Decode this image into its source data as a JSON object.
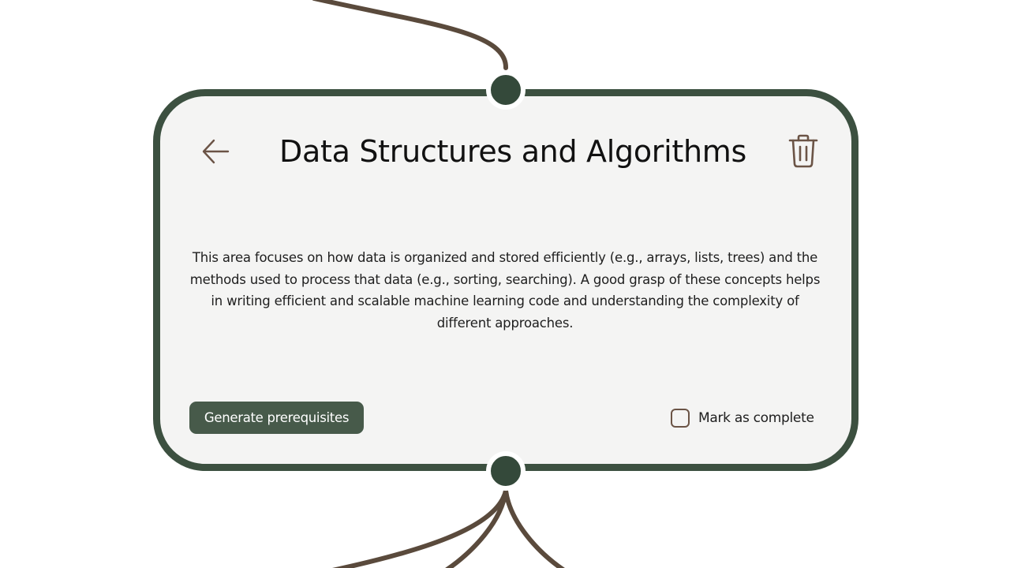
{
  "node": {
    "title": "Data Structures and Algorithms",
    "description": "This area focuses on how data is organized and stored efficiently (e.g., arrays, lists, trees) and the methods used to process that data (e.g., sorting, searching). A good grasp of these concepts helps in writing efficient and scalable machine learning code and understanding the complexity of different approaches.",
    "back_icon": "arrow-left-icon",
    "delete_icon": "trash-icon",
    "generate_label": "Generate prerequisites",
    "complete_label": "Mark as complete",
    "completed": false
  },
  "colors": {
    "card_border": "#3c5040",
    "card_background": "#f4f4f3",
    "connector": "#34493a",
    "edge": "#5a4a3c",
    "button_background": "#475a4a",
    "icon_brown": "#6b5446"
  }
}
